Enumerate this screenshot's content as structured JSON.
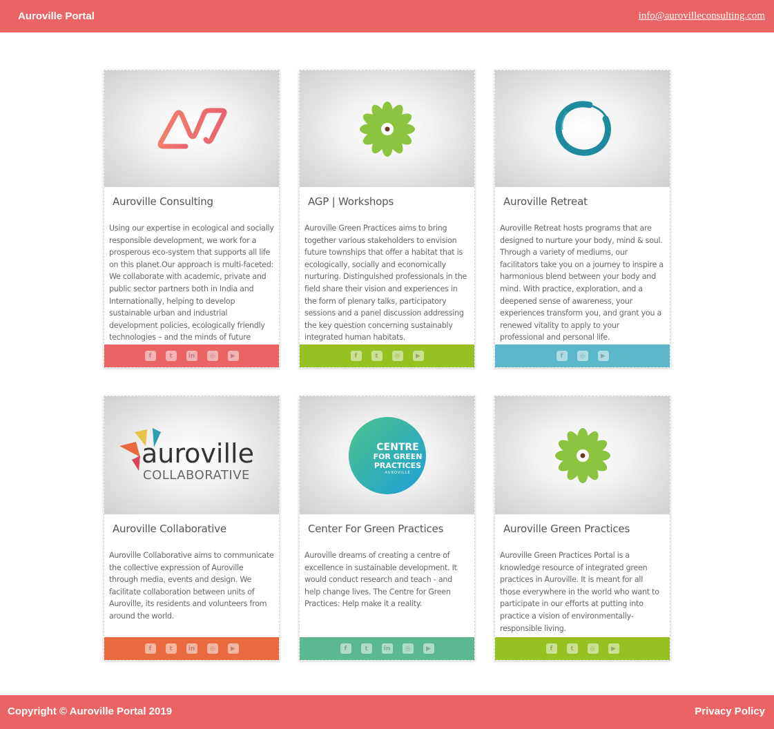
{
  "header": {
    "brand": "Auroville Portal",
    "email": "info@aurovilleconsulting.com"
  },
  "cards": [
    {
      "title": "Auroville Consulting",
      "text": "Using our expertise in ecological and socially responsible development, we work for a prosperous eco-system that supports all life on this planet.Our approach is multi-faceted: We collaborate with academic, private and public sector partners both in India and Internationally, helping to develop sustainable urban and industrial development policies, ecologically friendly technologies – and the minds of future leaders.",
      "color": "#ea6466",
      "logo": "auroville-consulting-logo",
      "social": [
        "facebook-icon",
        "twitter-icon",
        "linkedin-icon",
        "instagram-icon",
        "youtube-icon"
      ]
    },
    {
      "title": "AGP | Workshops",
      "text": "Auroville Green Practices aims to bring together various stakeholders to envision future townships that offer a habitat that is ecologically, socially and economically nurturing. Distinguished professionals in the field share their vision and experiences in the form of plenary talks, participatory sessions and a panel discussion addressing the key question concerning sustainably integrated human habitats.",
      "color": "#97c123",
      "logo": "green-flower-logo",
      "social": [
        "facebook-icon",
        "twitter-icon",
        "instagram-icon",
        "youtube-icon"
      ]
    },
    {
      "title": "Auroville Retreat",
      "text": "Auroville Retreat hosts programs that are designed to nurture your body, mind & soul. Through a variety of mediums, our facilitators take you on a journey to inspire a harmonious blend between your body and mind. With practice, exploration, and a deepened sense of awareness, your experiences transform you, and grant you a renewed vitality to apply to your professional and personal life.",
      "color": "#5bb8c8",
      "logo": "enso-circle-logo",
      "social": [
        "facebook-icon",
        "instagram-icon",
        "youtube-icon"
      ]
    },
    {
      "title": "Auroville Collaborative",
      "text": "Auroville Collaborative aims to communicate the collective expression of Auroville through media, events and design. We facilitate collaboration between units of Auroville, its residents and volunteers from around the world.",
      "color": "#ea6a40",
      "logo": "auroville-collaborative-logo",
      "logo_text_main": "auroville",
      "logo_text_sub": "COLLABORATIVE",
      "social": [
        "facebook-icon",
        "twitter-icon",
        "linkedin-icon",
        "instagram-icon",
        "youtube-icon"
      ]
    },
    {
      "title": "Center For Green Practices",
      "text": "Auroville dreams of creating a centre of excellence in sustainable development. It would conduct research and teach - and help change lives. The Centre for Green Practices: Help make it a reality.",
      "color": "#5bb892",
      "logo": "centre-green-practices-logo",
      "logo_lines": [
        "CENTRE",
        "FOR GREEN",
        "PRACTICES",
        "AUROVILLE"
      ],
      "social": [
        "facebook-icon",
        "twitter-icon",
        "linkedin-icon",
        "instagram-icon",
        "youtube-icon"
      ]
    },
    {
      "title": "Auroville Green Practices",
      "text": "Auroville Green Practices Portal is a knowledge resource of integrated green practices in Auroville. It is meant for all those everywhere in the world who want to participate in our efforts at putting into practice a vision of environmentally-responsible living.",
      "color": "#97c123",
      "logo": "green-flower-logo",
      "social": [
        "facebook-icon",
        "twitter-icon",
        "instagram-icon",
        "youtube-icon"
      ]
    }
  ],
  "footer": {
    "copyright": "Copyright © Auroville Portal 2019",
    "privacy": "Privacy Policy"
  }
}
